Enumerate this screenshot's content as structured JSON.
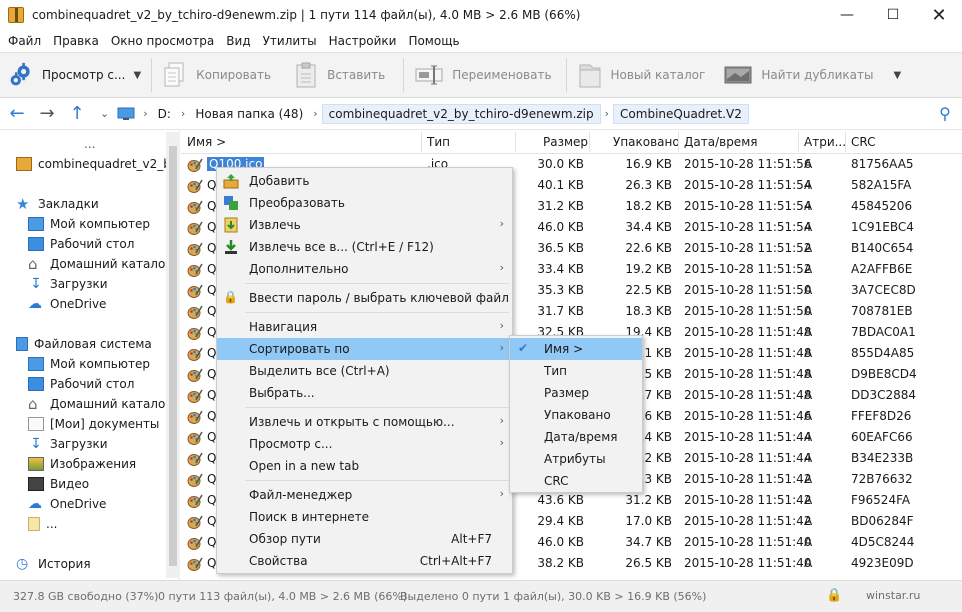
{
  "window": {
    "title": "combinequadret_v2_by_tchiro-d9enewm.zip | 1 пути 114 файл(ы), 4.0 MB > 2.6 MB (66%)"
  },
  "menu": [
    "Файл",
    "Правка",
    "Окно просмотра",
    "Вид",
    "Утилиты",
    "Настройки",
    "Помощь"
  ],
  "toolbar": {
    "view": "Просмотр с...",
    "copy": "Копировать",
    "paste": "Вставить",
    "rename": "Переименовать",
    "newfolder": "Новый каталог",
    "duplicates": "Найти дубликаты"
  },
  "address": {
    "drive": "D:",
    "crumbs": [
      "Новая папка (48)",
      "combinequadret_v2_by_tchiro-d9enewm.zip",
      "CombineQuadret.V2"
    ]
  },
  "sidebar": {
    "more": "...",
    "archive": "combinequadret_v2_by_...",
    "bookmarks": "Закладки",
    "bm_items": [
      "Мой компьютер",
      "Рабочий стол",
      "Домашний каталог",
      "Загрузки",
      "OneDrive"
    ],
    "filesystem": "Файловая система",
    "fs_items": [
      "Мой компьютер",
      "Рабочий стол",
      "Домашний каталог",
      "[Мои] документы",
      "Загрузки",
      "Изображения",
      "Видео",
      "OneDrive",
      "..."
    ],
    "history": "История"
  },
  "columns": {
    "name": "Имя >",
    "type": "Тип",
    "size": "Размер",
    "packed": "Упаковано",
    "date": "Дата/время",
    "attr": "Атри...",
    "crc": "CRC"
  },
  "rows": [
    {
      "name": "Q100.ico",
      "type": ".ico",
      "size": "30.0 KB",
      "packed": "16.9 KB",
      "date": "2015-10-28 11:51:56",
      "attr": "A",
      "crc": "81756AA5"
    },
    {
      "name": "Q",
      "type": "",
      "size": "40.1 KB",
      "packed": "26.3 KB",
      "date": "2015-10-28 11:51:54",
      "attr": "A",
      "crc": "582A15FA"
    },
    {
      "name": "Q",
      "type": "",
      "size": "31.2 KB",
      "packed": "18.2 KB",
      "date": "2015-10-28 11:51:54",
      "attr": "A",
      "crc": "45845206"
    },
    {
      "name": "Q",
      "type": "",
      "size": "46.0 KB",
      "packed": "34.4 KB",
      "date": "2015-10-28 11:51:54",
      "attr": "A",
      "crc": "1C91EBC4"
    },
    {
      "name": "Q",
      "type": "",
      "size": "36.5 KB",
      "packed": "22.6 KB",
      "date": "2015-10-28 11:51:52",
      "attr": "A",
      "crc": "B140C654"
    },
    {
      "name": "Q",
      "type": "",
      "size": "33.4 KB",
      "packed": "19.2 KB",
      "date": "2015-10-28 11:51:52",
      "attr": "A",
      "crc": "A2AFFB6E"
    },
    {
      "name": "Q",
      "type": "",
      "size": "35.3 KB",
      "packed": "22.5 KB",
      "date": "2015-10-28 11:51:50",
      "attr": "A",
      "crc": "3A7CEC8D"
    },
    {
      "name": "Q",
      "type": "",
      "size": "31.7 KB",
      "packed": "18.3 KB",
      "date": "2015-10-28 11:51:50",
      "attr": "A",
      "crc": "708781EB"
    },
    {
      "name": "Q",
      "type": "",
      "size": "32.5 KB",
      "packed": "19.4 KB",
      "date": "2015-10-28 11:51:48",
      "attr": "A",
      "crc": "7BDAC0A1"
    },
    {
      "name": "Q",
      "type": "",
      "size": "",
      "packed": "3.1 KB",
      "date": "2015-10-28 11:51:48",
      "attr": "A",
      "crc": "855D4A85"
    },
    {
      "name": "Q",
      "type": "",
      "size": "",
      "packed": "3.5 KB",
      "date": "2015-10-28 11:51:48",
      "attr": "A",
      "crc": "D9BE8CD4"
    },
    {
      "name": "Q",
      "type": "",
      "size": "",
      "packed": "7.7 KB",
      "date": "2015-10-28 11:51:48",
      "attr": "A",
      "crc": "DD3C2884"
    },
    {
      "name": "Q",
      "type": "",
      "size": "",
      "packed": "3.6 KB",
      "date": "2015-10-28 11:51:46",
      "attr": "A",
      "crc": "FFEF8D26"
    },
    {
      "name": "Q",
      "type": "",
      "size": "",
      "packed": "3.4 KB",
      "date": "2015-10-28 11:51:44",
      "attr": "A",
      "crc": "60EAFC66"
    },
    {
      "name": "Q",
      "type": "",
      "size": "",
      "packed": "3.2 KB",
      "date": "2015-10-28 11:51:44",
      "attr": "A",
      "crc": "B34E233B"
    },
    {
      "name": "Q",
      "type": "",
      "size": "",
      "packed": "3.3 KB",
      "date": "2015-10-28 11:51:42",
      "attr": "A",
      "crc": "72B76632"
    },
    {
      "name": "Q",
      "type": "",
      "size": "43.6 KB",
      "packed": "31.2 KB",
      "date": "2015-10-28 11:51:42",
      "attr": "A",
      "crc": "F96524FA"
    },
    {
      "name": "Q",
      "type": "",
      "size": "29.4 KB",
      "packed": "17.0 KB",
      "date": "2015-10-28 11:51:42",
      "attr": "A",
      "crc": "BD06284F"
    },
    {
      "name": "Q",
      "type": "",
      "size": "46.0 KB",
      "packed": "34.7 KB",
      "date": "2015-10-28 11:51:40",
      "attr": "A",
      "crc": "4D5C8244"
    },
    {
      "name": "Q",
      "type": "",
      "size": "38.2 KB",
      "packed": "26.5 KB",
      "date": "2015-10-28 11:51:40",
      "attr": "A",
      "crc": "4923E09D"
    }
  ],
  "context_menu": {
    "add": "Добавить",
    "convert": "Преобразовать",
    "extract": "Извлечь",
    "extract_all": "Извлечь все в... (Ctrl+E / F12)",
    "more": "Дополнительно",
    "password": "Ввести пароль / выбрать ключевой файл",
    "navigation": "Навигация",
    "sort": "Сортировать по",
    "select_all": "Выделить все (Ctrl+A)",
    "select": "Выбрать...",
    "extract_open": "Извлечь и открыть с помощью...",
    "view_with": "Просмотр с...",
    "new_tab": "Open in a new tab",
    "file_manager": "Файл-менеджер",
    "web_search": "Поиск в интернете",
    "path_overview": "Обзор пути",
    "path_shortcut": "Alt+F7",
    "properties": "Свойства",
    "properties_shortcut": "Ctrl+Alt+F7"
  },
  "sort_submenu": [
    "Имя >",
    "Тип",
    "Размер",
    "Упаковано",
    "Дата/время",
    "Атрибуты",
    "CRC"
  ],
  "status": {
    "free": "327.8 GB свободно (37%)",
    "summary": "0 пути 113 файл(ы), 4.0 MB > 2.6 MB (66%)",
    "selected": "Выделено 0 пути 1 файл(ы), 30.0 KB > 16.9 KB (56%)",
    "watermark": "winstar.ru"
  }
}
